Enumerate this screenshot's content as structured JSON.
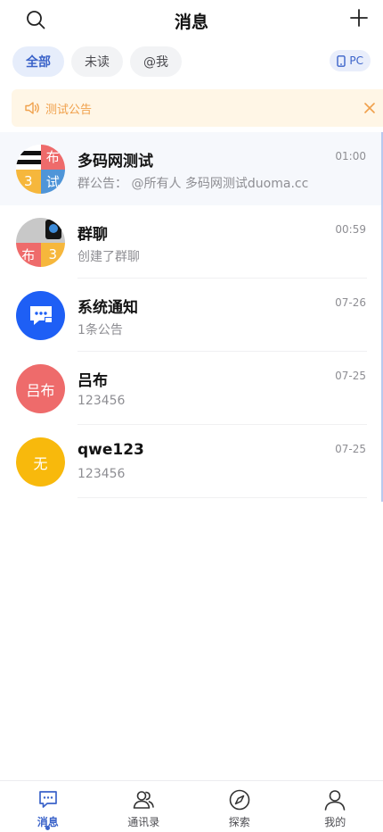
{
  "header": {
    "title": "消息",
    "search_icon": "search-icon",
    "add_icon": "plus-icon"
  },
  "filters": {
    "items": [
      {
        "label": "全部",
        "active": true
      },
      {
        "label": "未读",
        "active": false
      },
      {
        "label": "@我",
        "active": false
      }
    ],
    "pc_badge": "PC"
  },
  "notice": {
    "text": "测试公告",
    "icon": "speaker-icon",
    "close_icon": "close-icon"
  },
  "conversations": [
    {
      "name": "多码网测试",
      "message": "群公告： @所有人 多码网测试duoma.cc",
      "time": "01:00",
      "avatar": {
        "type": "group",
        "cells": [
          "",
          "布",
          "3",
          "试"
        ]
      }
    },
    {
      "name": "群聊",
      "message": "创建了群聊",
      "time": "00:59",
      "avatar": {
        "type": "group",
        "cells": [
          "",
          "",
          "布",
          "3"
        ]
      }
    },
    {
      "name": "系统通知",
      "message": "1条公告",
      "time": "07-26",
      "avatar": {
        "type": "icon",
        "icon": "chat-bubble-icon",
        "color": "#1e5ff5"
      }
    },
    {
      "name": "吕布",
      "message": "123456",
      "time": "07-25",
      "avatar": {
        "type": "text",
        "text": "吕布",
        "color": "#ee6b6b"
      }
    },
    {
      "name": "qwe123",
      "message": "123456",
      "time": "07-25",
      "avatar": {
        "type": "text",
        "text": "无",
        "color": "#f8b90c"
      }
    }
  ],
  "tabbar": {
    "items": [
      {
        "label": "消息",
        "icon": "message-icon",
        "active": true
      },
      {
        "label": "通讯录",
        "icon": "contacts-icon",
        "active": false
      },
      {
        "label": "探索",
        "icon": "compass-icon",
        "active": false
      },
      {
        "label": "我的",
        "icon": "profile-icon",
        "active": false
      }
    ]
  },
  "colors": {
    "accent": "#3b63c9",
    "notice_bg": "#fff6e6",
    "notice_text": "#f0a04b"
  }
}
